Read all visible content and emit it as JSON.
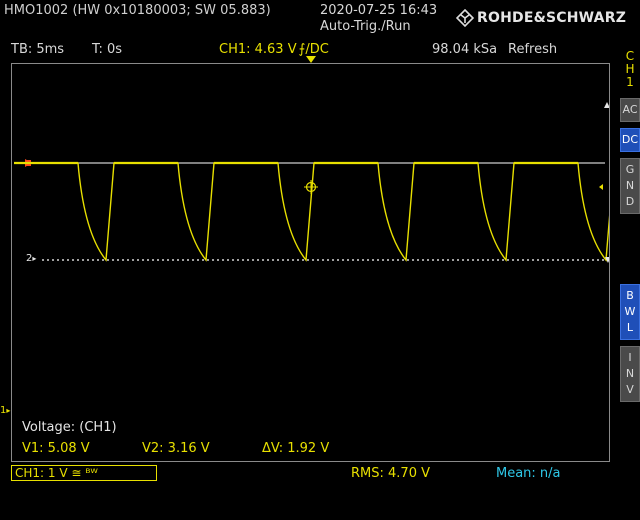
{
  "header": {
    "device": "HMO1002 (HW 0x10180003; SW 05.883)",
    "datetime": "2020-07-25 16:43",
    "trigger_mode": "Auto-Trig./Run",
    "brand": "ROHDE&SCHWARZ"
  },
  "status_bar": {
    "timebase": "TB: 5ms",
    "trigger_time": "T: 0s",
    "trigger_level": "CH1: 4.63 V",
    "trigger_slope": "⨍/DC",
    "sample_rate": "98.04 kSa",
    "acq_mode": "Refresh"
  },
  "side_panel": {
    "channel": [
      "C",
      "H",
      "1"
    ],
    "ac": "AC",
    "dc": "DC",
    "gnd": [
      "G",
      "N",
      "D"
    ],
    "bwl": [
      "B",
      "W",
      "L"
    ],
    "inv": [
      "I",
      "N",
      "V"
    ]
  },
  "screen": {
    "marker_ch2": "2",
    "marker_ch1": "1",
    "measure_title": "Voltage: (CH1)",
    "v1": "V1: 5.08 V",
    "v2": "V2: 3.16 V",
    "dv": "ΔV: 1.92 V"
  },
  "footer": {
    "channel_setting": "CH1: 1 V ≅ ᴮᵂ",
    "rms": "RMS: 4.70 V",
    "mean": "Mean: n/a"
  },
  "colors": {
    "ch1": "#e8e000",
    "cursor": "#ffffff",
    "background": "#000000",
    "active_button": "#1f4fb8",
    "mean_text": "#2ec8e8"
  },
  "waveform": {
    "high_level_v": 5.08,
    "low_level_v": 3.16,
    "period_ms": 10,
    "timebase_ms_per_div": 5
  }
}
